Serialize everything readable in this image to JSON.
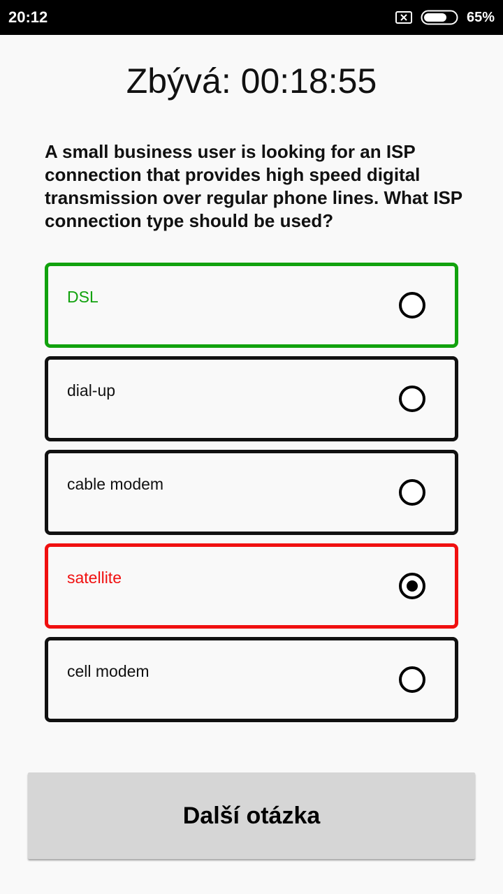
{
  "status_bar": {
    "time": "20:12",
    "sim_icon": "no-sim-icon",
    "battery_icon": "battery-icon",
    "battery_percent": "65%"
  },
  "timer": {
    "text": "Zbývá: 00:18:55"
  },
  "question": {
    "text": "A small business user is looking for an ISP connection that provides high speed digital transmission over regular phone lines. What ISP connection type should be used?"
  },
  "options": [
    {
      "label": "DSL",
      "state": "correct",
      "selected": false
    },
    {
      "label": "dial-up",
      "state": "normal",
      "selected": false
    },
    {
      "label": "cable modem",
      "state": "normal",
      "selected": false
    },
    {
      "label": "satellite",
      "state": "wrong",
      "selected": true
    },
    {
      "label": "cell modem",
      "state": "normal",
      "selected": false
    }
  ],
  "next_button": {
    "label": "Další otázka"
  },
  "colors": {
    "correct": "#12a20e",
    "wrong": "#f01010",
    "border": "#111111",
    "button_bg": "#d6d6d6"
  }
}
